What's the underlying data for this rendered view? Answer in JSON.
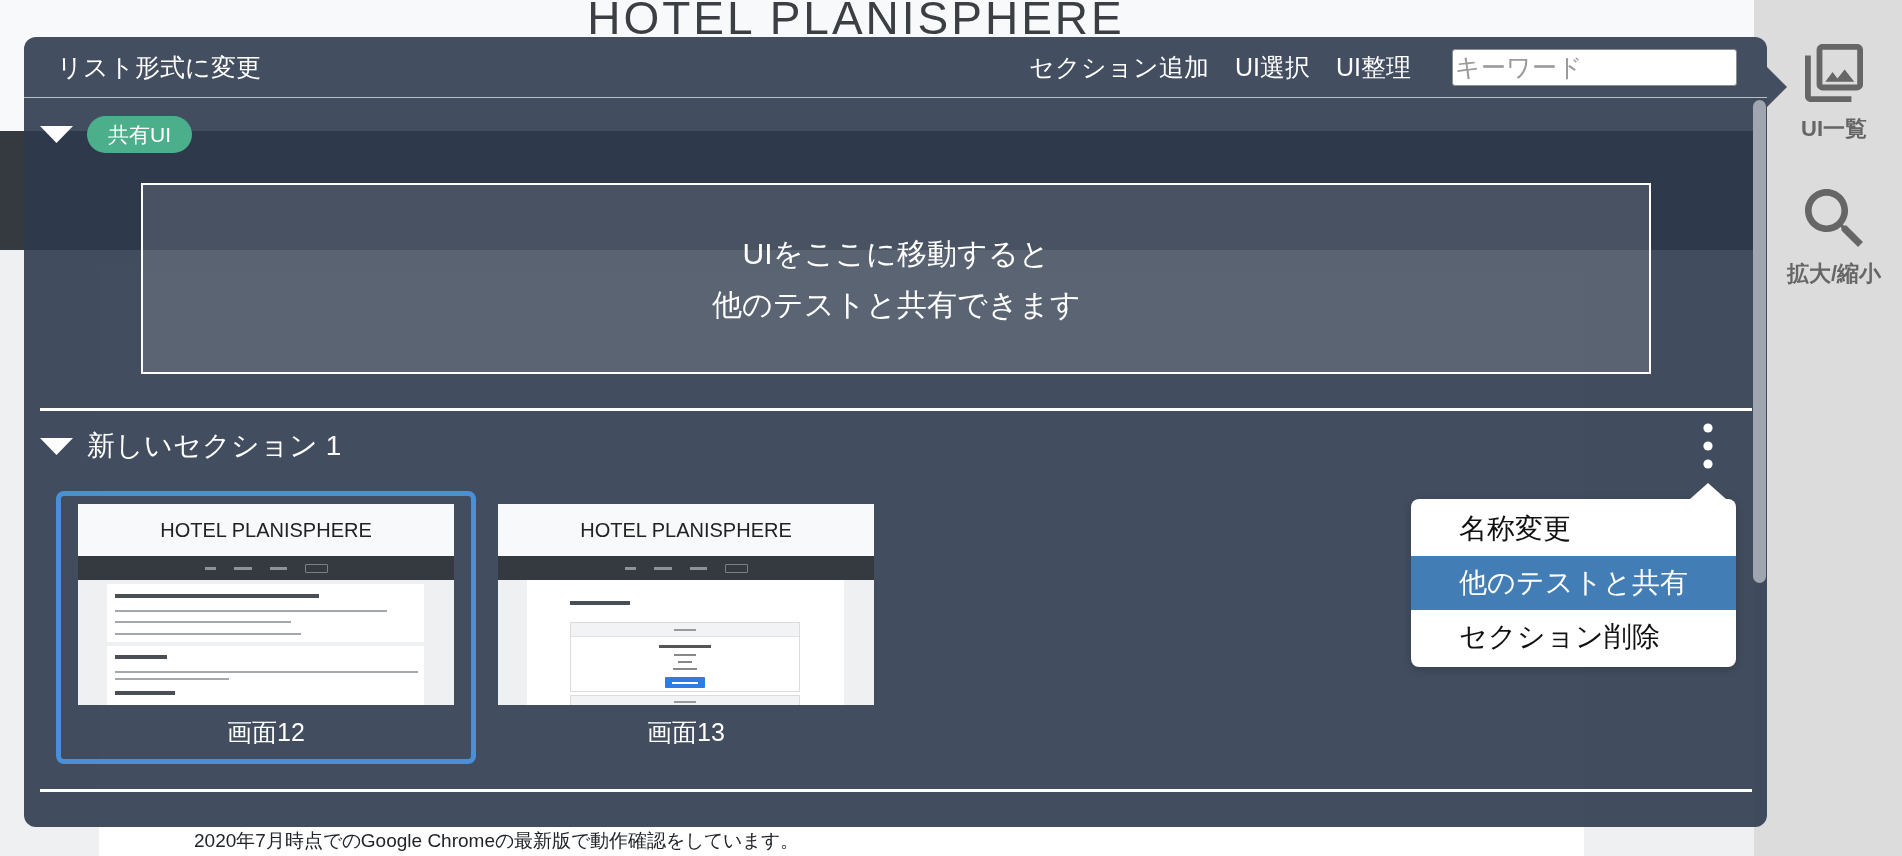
{
  "background_page": {
    "site_title": "HOTEL PLANISPHERE",
    "notes_item": "2020年7月時点でのGoogle Chromeの最新版で動作確認をしています。"
  },
  "panel": {
    "toolbar": {
      "view_toggle": "リスト形式に変更",
      "actions": [
        "セクション追加",
        "UI選択",
        "UI整理"
      ],
      "search": {
        "placeholder": "キーワード"
      }
    },
    "sections": [
      {
        "kind": "shared",
        "expanded": true,
        "badge": "共有UI",
        "drop_hint": [
          "UIをここに移動すると",
          "他のテストと共有できます"
        ]
      },
      {
        "kind": "custom",
        "expanded": true,
        "title": "新しいセクション 1",
        "menu": {
          "open": true,
          "items": [
            {
              "label": "名称変更",
              "selected": false
            },
            {
              "label": "他のテストと共有",
              "selected": true
            },
            {
              "label": "セクション削除",
              "selected": false
            }
          ]
        },
        "screens": [
          {
            "label": "画面12",
            "selected": true,
            "preview": {
              "kind": "home",
              "site_title": "HOTEL PLANISPHERE"
            }
          },
          {
            "label": "画面13",
            "selected": false,
            "preview": {
              "kind": "plans",
              "site_title": "HOTEL PLANISPHERE"
            }
          }
        ]
      }
    ]
  },
  "sidebar": {
    "items": [
      {
        "label": "UI一覧",
        "kind": "ui_list"
      },
      {
        "label": "拡大/縮小",
        "kind": "zoom"
      }
    ]
  }
}
